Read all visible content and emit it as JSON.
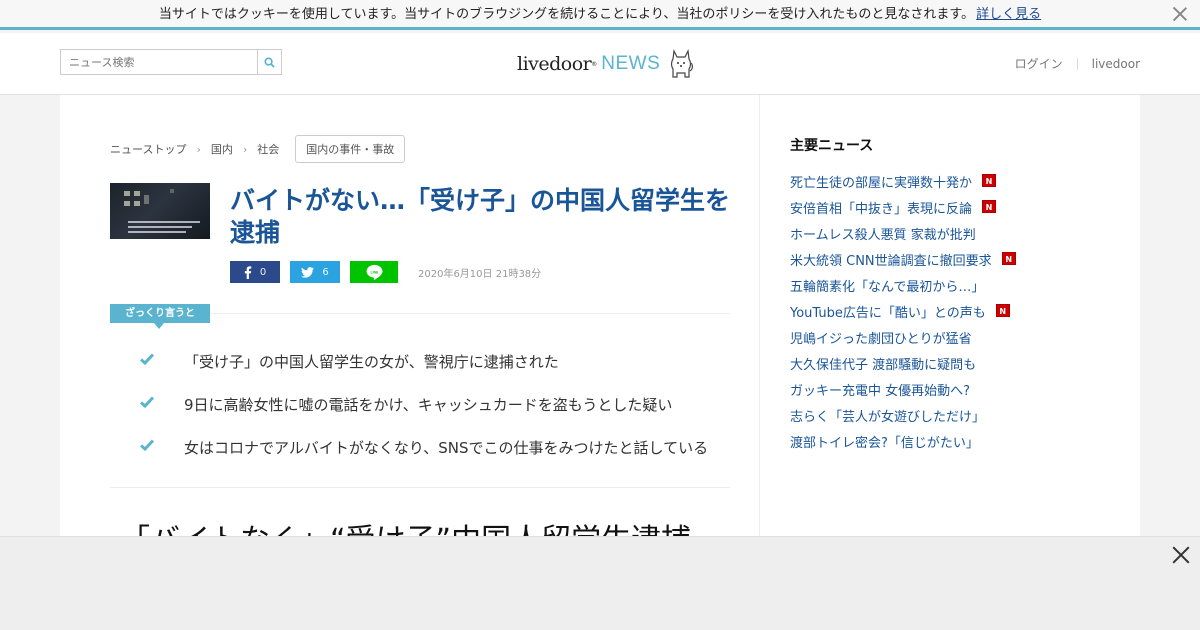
{
  "cookie_bar": {
    "message": "当サイトではクッキーを使用しています。当サイトのブラウジングを続けることにより、当社のポリシーを受け入れたものと見なされます。",
    "more_link": "詳しく見る",
    "close_icon": "close-icon"
  },
  "header": {
    "search_placeholder": "ニュース検索",
    "logo_text": "livedoor",
    "logo_reg": "®",
    "logo_news": "NEWS",
    "login": "ログイン",
    "livedoor_link": "livedoor"
  },
  "breadcrumb": {
    "items": [
      "ニューストップ",
      "国内",
      "社会"
    ],
    "tag": "国内の事件・事故"
  },
  "article": {
    "title": "バイトがない…「受け子」の中国人留学生を逮捕",
    "share": {
      "facebook_count": "0",
      "twitter_count": "6"
    },
    "date": "2020年6月10日 21時38分",
    "summary_label": "ざっくり言うと",
    "points": [
      "「受け子」の中国人留学生の女が、警視庁に逮捕された",
      "9日に高齢女性に嘘の電話をかけ、キャッシュカードを盗もうとした疑い",
      "女はコロナでアルバイトがなくなり、SNSでこの仕事をみつけたと話している"
    ],
    "headline": "「バイトなく」“受け子”中国人留学生逮捕"
  },
  "sidebar": {
    "heading": "主要ニュース",
    "new_badge": "N",
    "items": [
      {
        "text": "死亡生徒の部屋に実弾数十発か",
        "is_new": true
      },
      {
        "text": "安倍首相「中抜き」表現に反論",
        "is_new": true
      },
      {
        "text": "ホームレス殺人悪質 家裁が批判",
        "is_new": false
      },
      {
        "text": "米大統領 CNN世論調査に撤回要求",
        "is_new": true
      },
      {
        "text": "五輪簡素化「なんで最初から…」",
        "is_new": false
      },
      {
        "text": "YouTube広告に「酷い」との声も",
        "is_new": true
      },
      {
        "text": "児嶋イジった劇団ひとりが猛省",
        "is_new": false
      },
      {
        "text": "大久保佳代子 渡部騒動に疑問も",
        "is_new": false
      },
      {
        "text": "ガッキー充電中 女優再始動へ?",
        "is_new": false
      },
      {
        "text": "志らく「芸人が女遊びしただけ」",
        "is_new": false
      },
      {
        "text": "渡部トイレ密会?「信じがたい」",
        "is_new": false
      }
    ]
  },
  "colors": {
    "accent": "#5ab4cf",
    "link": "#1a5598",
    "facebook": "#2c4a8b",
    "twitter": "#2aa3e0",
    "line": "#00c300",
    "new_badge": "#cc0000"
  }
}
